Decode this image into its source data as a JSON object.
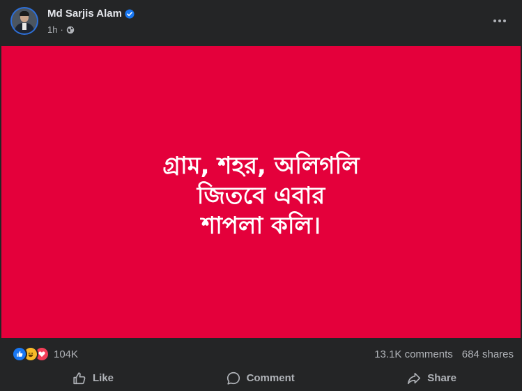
{
  "post": {
    "author": "Md Sarjis Alam",
    "time": "1h",
    "separator": "·",
    "image_lines": [
      "গ্রাম, শহর, অলিগলি",
      "জিতবে এবার",
      "শাপলা কলি।"
    ],
    "image_bg": "#e4003b"
  },
  "stats": {
    "reaction_count": "104K",
    "comments": "13.1K comments",
    "shares": "684 shares",
    "reactions": [
      "like-reaction-icon",
      "haha-reaction-icon",
      "love-reaction-icon"
    ]
  },
  "actions": {
    "like": "Like",
    "comment": "Comment",
    "share": "Share"
  },
  "colors": {
    "background": "#242526",
    "text": "#e4e6eb",
    "muted": "#b0b3b8",
    "accent": "#1877f2"
  }
}
